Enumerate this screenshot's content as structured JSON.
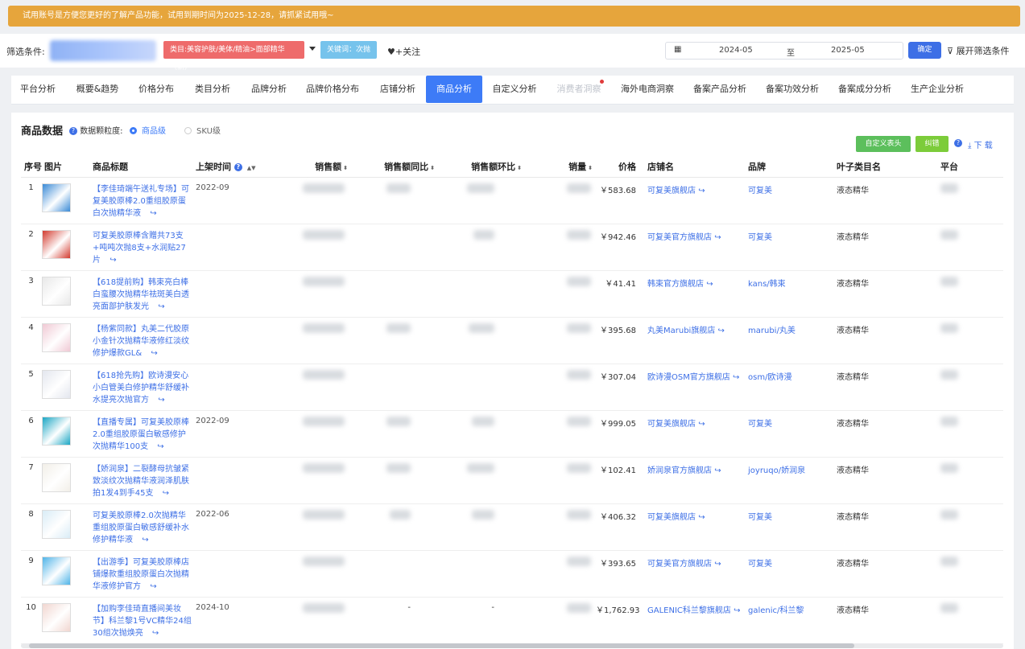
{
  "banner": {
    "text": "试用账号是方便您更好的了解产品功能，试用到期时间为2025-12-28，请抓紧试用哦~"
  },
  "filters": {
    "label": "筛选条件:",
    "category_tag": "类目:美容护肤/美体/精油>面部精华（新）",
    "keyword_tag": "关键词：次抛",
    "follow": "♥+关注",
    "date_from": "2024-05",
    "date_sep": "至",
    "date_to": "2025-05",
    "confirm": "确定",
    "expand": "展开筛选条件"
  },
  "tabs": [
    {
      "label": "平台分析"
    },
    {
      "label": "概要&趋势"
    },
    {
      "label": "价格分布"
    },
    {
      "label": "类目分析"
    },
    {
      "label": "品牌分析"
    },
    {
      "label": "品牌价格分布"
    },
    {
      "label": "店铺分析"
    },
    {
      "label": "商品分析"
    },
    {
      "label": "自定义分析"
    },
    {
      "label": "消费者洞察"
    },
    {
      "label": "海外电商洞察"
    },
    {
      "label": "备案产品分析"
    },
    {
      "label": "备案功效分析"
    },
    {
      "label": "备案成分分析"
    },
    {
      "label": "生产企业分析"
    }
  ],
  "active_tab": "商品分析",
  "product": {
    "title": "商品数据",
    "granularity_label": "数据颗粒度:",
    "option_product": "商品级",
    "option_sku": "SKU级",
    "btn_custom_header": "自定义表头",
    "btn_correct": "纠错",
    "download": "下 载"
  },
  "columns": [
    "序号",
    "图片",
    "商品标题",
    "上架时间",
    "销售额",
    "销售额同比",
    "销售额环比",
    "销量",
    "价格",
    "店铺名",
    "品牌",
    "叶子类目名",
    "平台"
  ],
  "rows": [
    {
      "idx": "1",
      "title": "【李佳琦端午送礼专场】可复美胶原棒2.0重组胶原蛋白次抛精华液",
      "date": "2022-09",
      "yoy": "",
      "mom": "",
      "price": "￥583.68",
      "shop": "可复美旗舰店",
      "brand": "可复美",
      "cat": "液态精华"
    },
    {
      "idx": "2",
      "title": "可复美胶原棒含赠共73支+吨吨次抛8支+水润贴27片",
      "date": "",
      "yoy": "",
      "mom": "",
      "price": "￥942.46",
      "shop": "可复美官方旗舰店",
      "brand": "可复美",
      "cat": "液态精华"
    },
    {
      "idx": "3",
      "title": "【618提前购】韩束亮白棒白蛮腰次抛精华祛斑美白透亮面部护肤发光",
      "date": "",
      "yoy": "",
      "mom": "",
      "price": "￥41.41",
      "shop": "韩束官方旗舰店",
      "brand": "kans/韩束",
      "cat": "液态精华"
    },
    {
      "idx": "4",
      "title": "【杨紫同款】丸美二代胶原小金针次抛精华液修红淡纹修护爆款GL&",
      "date": "",
      "yoy": "",
      "mom": "",
      "price": "￥395.68",
      "shop": "丸美Marubi旗舰店",
      "brand": "marubi/丸美",
      "cat": "液态精华"
    },
    {
      "idx": "5",
      "title": "【618抢先购】欧诗漫安心小白管美白修护精华舒缓补水提亮次抛官方",
      "date": "",
      "yoy": "",
      "mom": "",
      "price": "￥307.04",
      "shop": "欧诗漫OSM官方旗舰店",
      "brand": "osm/欧诗漫",
      "cat": "液态精华"
    },
    {
      "idx": "6",
      "title": "【直播专属】可复美胶原棒2.0重组胶原蛋白敏感修护次抛精华100支",
      "date": "2022-09",
      "yoy": "",
      "mom": "",
      "price": "￥999.05",
      "shop": "可复美旗舰店",
      "brand": "可复美",
      "cat": "液态精华"
    },
    {
      "idx": "7",
      "title": "【娇润泉】二裂酵母抗皱紧致淡纹次抛精华液润泽肌肤拍1发4到手45支",
      "date": "",
      "yoy": "",
      "mom": "",
      "price": "￥102.41",
      "shop": "娇润泉官方旗舰店",
      "brand": "joyruqo/娇润泉",
      "cat": "液态精华"
    },
    {
      "idx": "8",
      "title": "可复美胶原棒2.0次抛精华重组胶原蛋白敏感舒缓补水修护精华液",
      "date": "2022-06",
      "yoy": "",
      "mom": "",
      "price": "￥406.32",
      "shop": "可复美旗舰店",
      "brand": "可复美",
      "cat": "液态精华"
    },
    {
      "idx": "9",
      "title": "【出游季】可复美胶原棒店铺爆款重组胶原蛋白次抛精华液修护官方",
      "date": "",
      "yoy": "",
      "mom": "",
      "price": "￥393.65",
      "shop": "可复美官方旗舰店",
      "brand": "可复美",
      "cat": "液态精华"
    },
    {
      "idx": "10",
      "title": "【加购李佳琦直播间美妆节】科兰黎1号VC精华24组30组次抛焕亮",
      "date": "2024-10",
      "yoy": "-",
      "mom": "-",
      "price": "￥1,762.93",
      "shop": "GALENIC科兰黎旗舰店",
      "brand": "galenic/科兰黎",
      "cat": "液态精华"
    }
  ],
  "colors": {
    "accent": "#3d7bf7",
    "banner": "#e6a53c",
    "tag_red": "#ee6b6b",
    "tag_blue": "#76c3ec",
    "green": "#5cbf5c",
    "green2": "#7ccc3a"
  }
}
